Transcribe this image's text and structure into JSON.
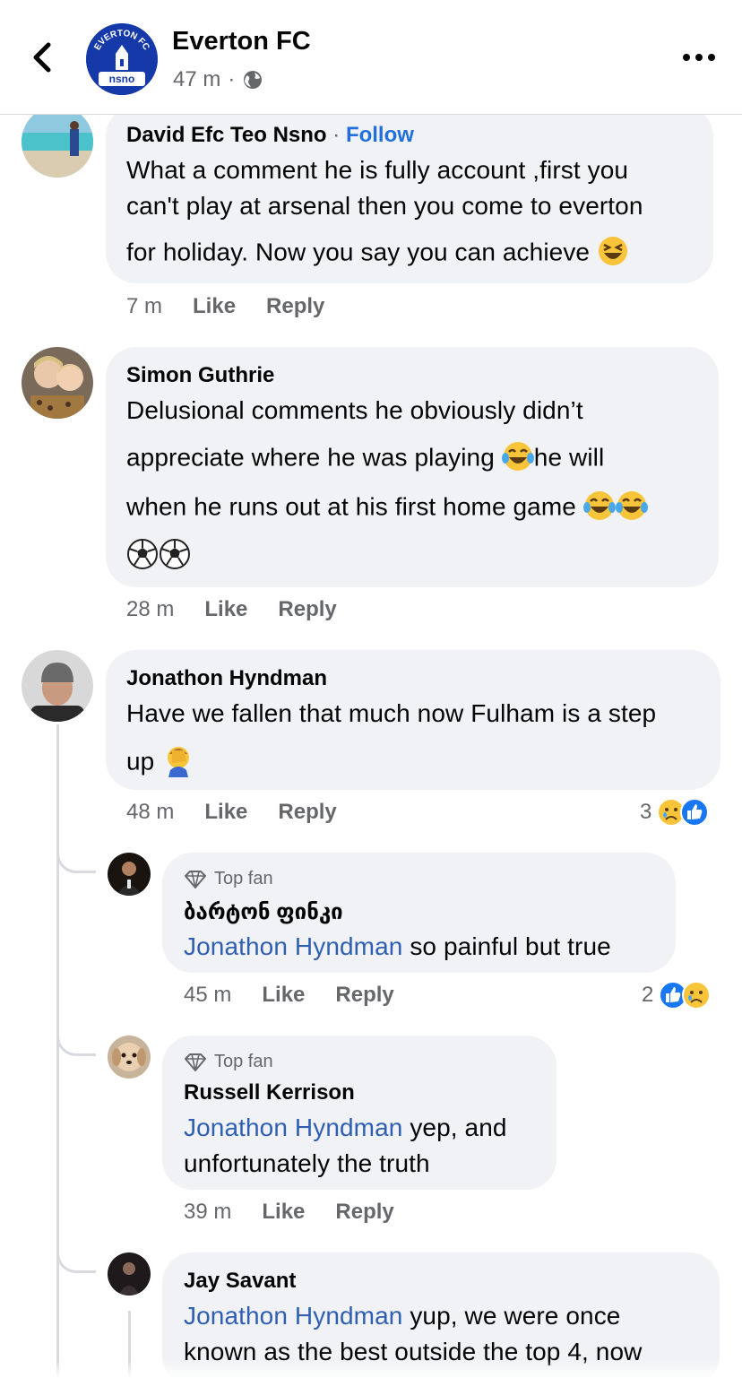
{
  "header": {
    "page_name": "Everton FC",
    "age": "47 m",
    "separator": "·",
    "logo_top_text": "EVERTON FC",
    "logo_bottom_text": "nsno"
  },
  "comments": [
    {
      "author": "David Efc Teo Nsno",
      "follow_label": "Follow",
      "lines": [
        "What a comment he is fully account ,first you",
        "can't play at arsenal then you come to everton",
        "for holiday. Now you say you can achieve"
      ],
      "time": "7 m",
      "like_label": "Like",
      "reply_label": "Reply"
    },
    {
      "author": "Simon Guthrie",
      "lines": [
        "Delusional comments he obviously didn’t",
        "appreciate where he was playing",
        "he will",
        "when he runs out at his first home game"
      ],
      "time": "28 m",
      "like_label": "Like",
      "reply_label": "Reply"
    },
    {
      "author": "Jonathon Hyndman",
      "lines": [
        "Have we fallen that much now Fulham is a step",
        "up"
      ],
      "time": "48 m",
      "like_label": "Like",
      "reply_label": "Reply",
      "reaction_count": "3"
    }
  ],
  "replies": [
    {
      "badge": "Top fan",
      "author": "ბარტონ ფინკი",
      "mention": "Jonathon Hyndman",
      "lines": [
        " so painful but true"
      ],
      "time": "45 m",
      "like_label": "Like",
      "reply_label": "Reply",
      "reaction_count": "2"
    },
    {
      "badge": "Top fan",
      "author": "Russell Kerrison",
      "mention": "Jonathon Hyndman",
      "lines": [
        " yep, and",
        "unfortunately the truth"
      ],
      "time": "39 m",
      "like_label": "Like",
      "reply_label": "Reply"
    },
    {
      "author": "Jay Savant",
      "mention": "Jonathon Hyndman",
      "lines": [
        " yup, we were once",
        "known as the best outside the top 4, now"
      ]
    }
  ],
  "colors": {
    "link_blue": "#216fdb",
    "mention_blue": "#2f5fb3",
    "bubble_gray": "#f0f2f5",
    "meta_gray": "#65676b",
    "logo_blue": "#1539a8"
  },
  "icons": [
    "back-chevron-icon",
    "globe-icon",
    "more-dots-icon",
    "top-fan-diamond-icon",
    "like-reaction-icon",
    "sad-reaction-icon",
    "laughing-emoji",
    "tears-of-joy-emoji",
    "soccer-ball-emoji",
    "facepalm-emoji"
  ]
}
